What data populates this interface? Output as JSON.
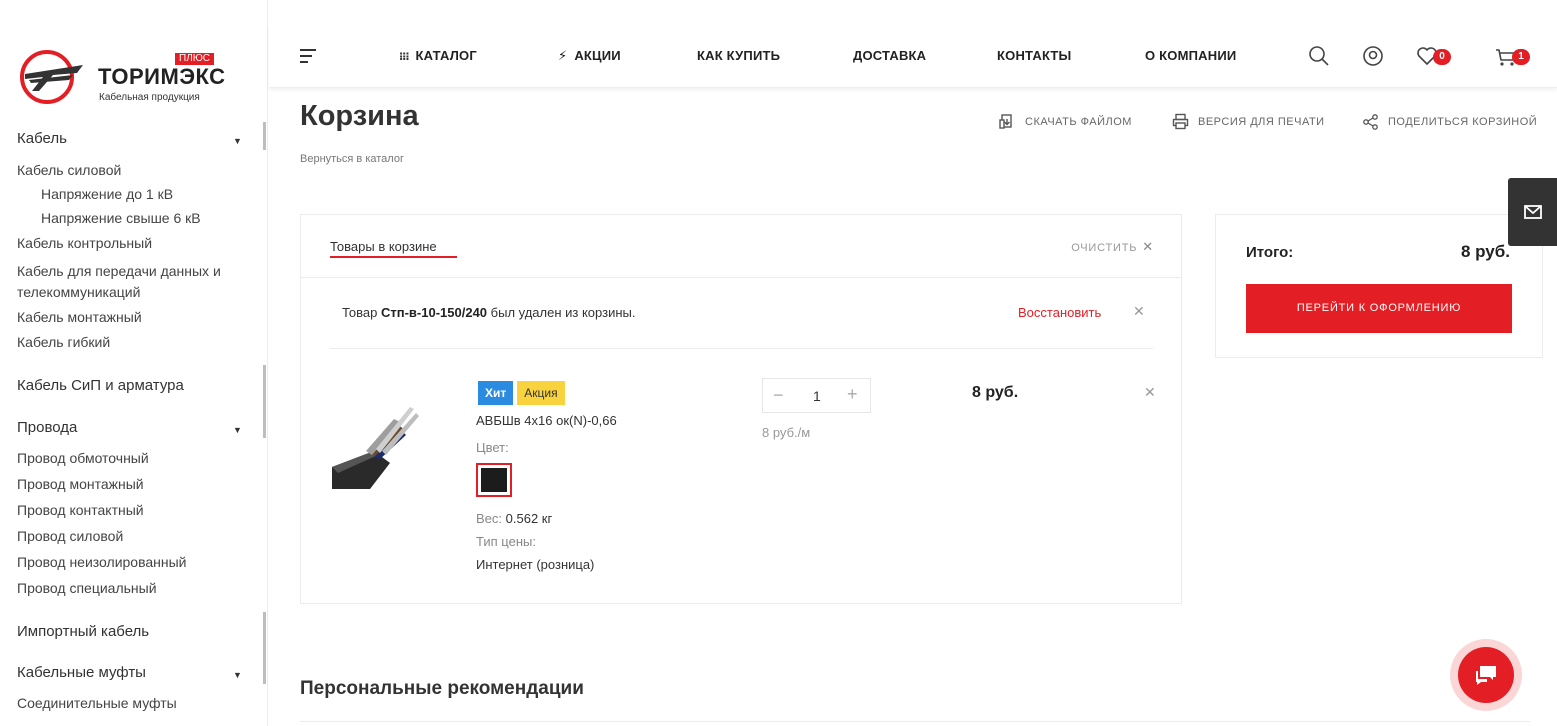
{
  "brand": {
    "name": "ТОРИМЭКС",
    "plus": "ПЛЮС",
    "tagline": "Кабельная продукция"
  },
  "sidebar": {
    "groups": [
      {
        "label": "Кабель",
        "items": [
          "Кабель силовой",
          "Напряжение до 1 кВ",
          "Напряжение свыше 6 кВ",
          "Кабель контрольный",
          "Кабель для передачи данных и телекоммуникаций",
          "Кабель монтажный",
          "Кабель гибкий"
        ]
      },
      {
        "label": "Кабель СиП и арматура"
      },
      {
        "label": "Провода",
        "items": [
          "Провод обмоточный",
          "Провод монтажный",
          "Провод контактный",
          "Провод силовой",
          "Провод неизолированный",
          "Провод специальный"
        ]
      },
      {
        "label": "Импортный кабель"
      },
      {
        "label": "Кабельные муфты",
        "items": [
          "Соединительные муфты"
        ]
      }
    ]
  },
  "header": {
    "menu": [
      "КАТАЛОГ",
      "АКЦИИ",
      "КАК КУПИТЬ",
      "ДОСТАВКА",
      "КОНТАКТЫ",
      "О КОМПАНИИ"
    ],
    "favorites_count": "0",
    "cart_count": "1"
  },
  "page": {
    "title": "Корзина",
    "back_link": "Вернуться в каталог",
    "actions": [
      "СКАЧАТЬ ФАЙЛОМ",
      "ВЕРСИЯ ДЛЯ ПЕЧАТИ",
      "ПОДЕЛИТЬСЯ КОРЗИНОЙ"
    ]
  },
  "cart": {
    "tab_label": "Товары в корзине",
    "clear_label": "ОЧИСТИТЬ",
    "removed_notice": {
      "prefix": "Товар ",
      "product": "Стп-в-10-150/240",
      "suffix": " был удален из корзины.",
      "restore_label": "Восстановить"
    },
    "item": {
      "tags": [
        "Хит",
        "Акция"
      ],
      "name": "АВБШв 4х16 ок(N)-0,66",
      "color_label": "Цвет:",
      "color": "#1c1c1c",
      "weight_label": "Вес:",
      "weight_value": "0.562 кг",
      "price_type_label": "Тип цены:",
      "price_type_value": "Интернет (розница)",
      "quantity": "1",
      "unit_price": "8 руб./м",
      "price": "8 руб."
    }
  },
  "summary": {
    "total_label": "Итого:",
    "total_value": "8 руб.",
    "checkout_label": "ПЕРЕЙТИ К ОФОРМЛЕНИЮ"
  },
  "recommendations": {
    "title": "Персональные рекомендации"
  },
  "colors": {
    "accent": "#e31e24",
    "hit": "#2a8be0",
    "sale": "#f9d33d"
  }
}
